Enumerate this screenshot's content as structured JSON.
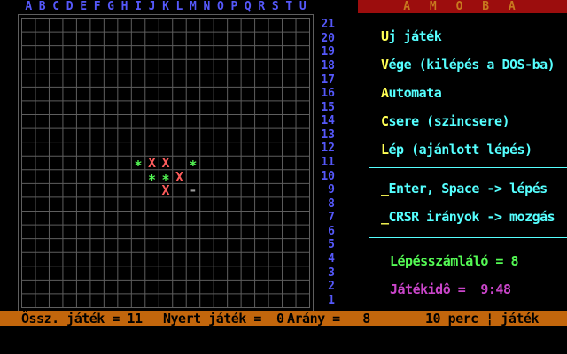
{
  "colors": {
    "label_blue": "#5558fa",
    "grid_grey": "#5e5e5e",
    "cyan": "#55ffff",
    "yellow": "#ffff55",
    "green": "#54fa54",
    "red": "#fd5c5c",
    "magenta": "#ca45ca",
    "cursor_grey": "#9a9a9a",
    "title_bg": "#9c0d0d",
    "title_fg": "#c8791f",
    "statusbar_bg": "#c2660c"
  },
  "title_bar": {
    "text": "A M Ô B A"
  },
  "board": {
    "columns": [
      "A",
      "B",
      "C",
      "D",
      "E",
      "F",
      "G",
      "H",
      "I",
      "J",
      "K",
      "L",
      "M",
      "N",
      "O",
      "P",
      "Q",
      "R",
      "S",
      "T",
      "U"
    ],
    "row_count": 21,
    "pieces": [
      {
        "col": "I",
        "row": 11,
        "glyph": "*",
        "color": "green",
        "kind": "star"
      },
      {
        "col": "J",
        "row": 11,
        "glyph": "X",
        "color": "red",
        "kind": "x"
      },
      {
        "col": "K",
        "row": 11,
        "glyph": "X",
        "color": "red",
        "kind": "x"
      },
      {
        "col": "M",
        "row": 11,
        "glyph": "*",
        "color": "green",
        "kind": "star"
      },
      {
        "col": "J",
        "row": 10,
        "glyph": "*",
        "color": "green",
        "kind": "star"
      },
      {
        "col": "K",
        "row": 10,
        "glyph": "*",
        "color": "green",
        "kind": "star"
      },
      {
        "col": "L",
        "row": 10,
        "glyph": "X",
        "color": "red",
        "kind": "x"
      },
      {
        "col": "K",
        "row": 9,
        "glyph": "X",
        "color": "red",
        "kind": "x"
      },
      {
        "col": "M",
        "row": 9,
        "glyph": "-",
        "color": "cursor_grey",
        "kind": "cursor"
      }
    ]
  },
  "menu": {
    "items": [
      {
        "hotkey": "U",
        "rest": "j játék"
      },
      {
        "hotkey": "V",
        "rest": "ége (kilépés a DOS-ba)"
      },
      {
        "hotkey": "A",
        "rest": "utomata"
      },
      {
        "hotkey": "C",
        "rest": "sere (szincsere)"
      },
      {
        "hotkey": "L",
        "rest": "ép (ajánlott lépés)"
      }
    ]
  },
  "shortcuts": {
    "items": [
      {
        "prefix": "_",
        "text": "Enter, Space -> lépés"
      },
      {
        "prefix": "_",
        "text": "CRSR irányok -> mozgás"
      }
    ]
  },
  "stats": {
    "move_counter": "Lépésszámláló = 8",
    "game_time": "Játékidô =  9:48"
  },
  "status_bar": {
    "total_games": "Össz. játék = 11",
    "won_games": "Nyert játék =  0",
    "ratio": "Arány =   8",
    "time_limit": "10 perc ¦ játék"
  }
}
